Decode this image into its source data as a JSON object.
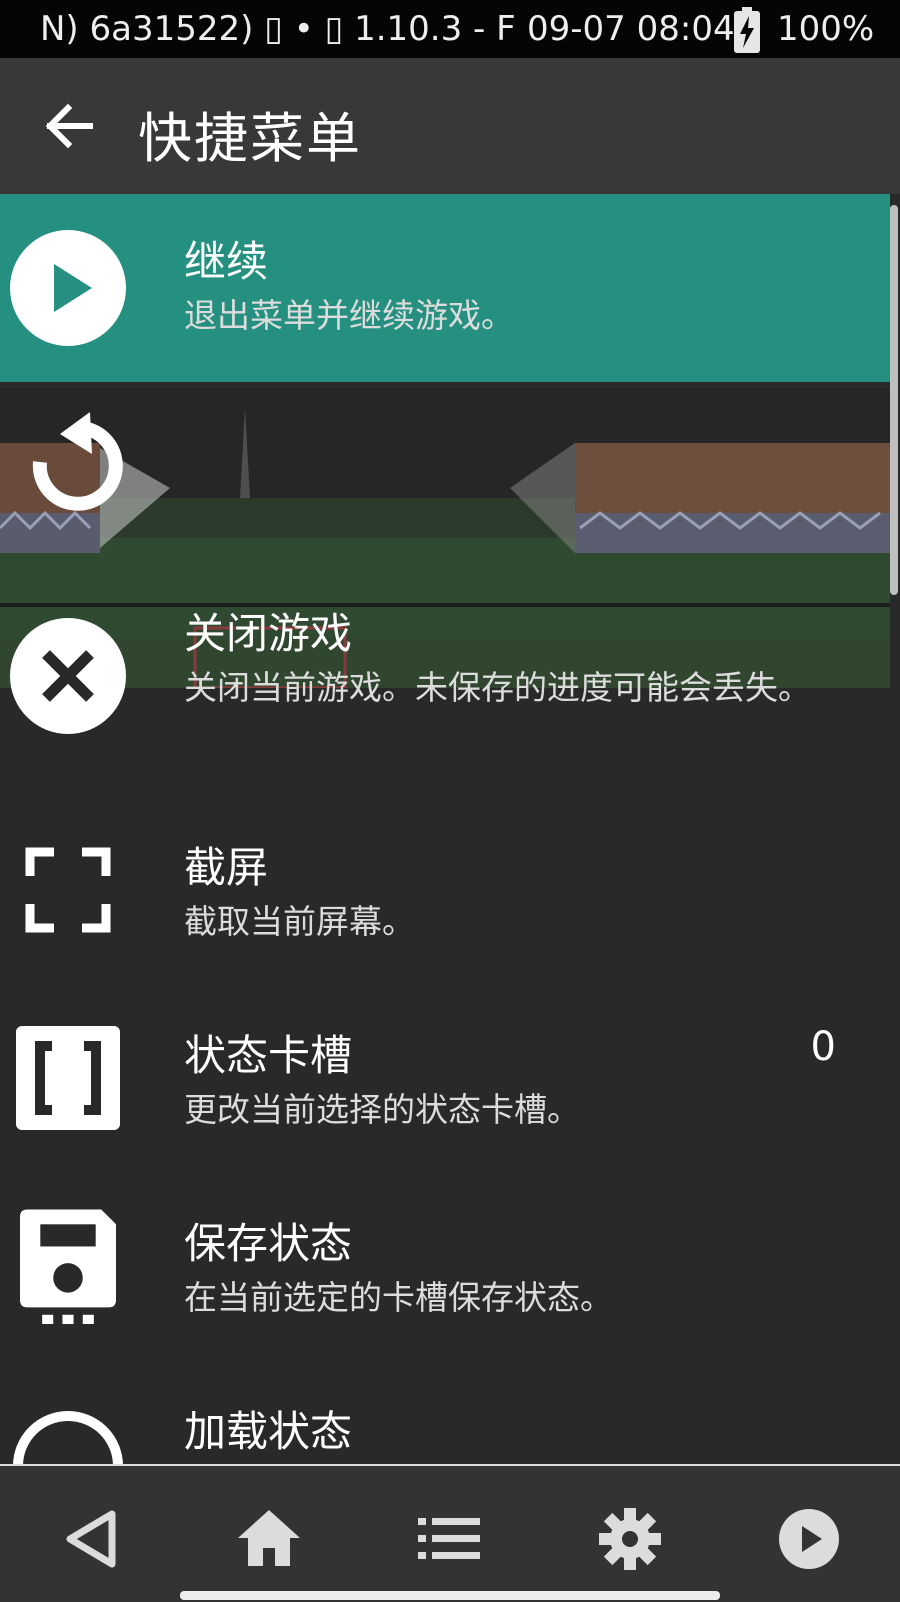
{
  "status_bar": {
    "left_text": "N) 6a31522) ▯ • ▯ 1.10.3 - F",
    "clock": "09-07 08:04",
    "battery_percent": "100%"
  },
  "header": {
    "title": "快捷菜单",
    "back_icon": "arrow-left-icon"
  },
  "menu": {
    "items": [
      {
        "title": "继续",
        "subtitle": "退出菜单并继续游戏。",
        "icon": "play-circle-icon",
        "selected": true
      },
      {
        "title": "",
        "subtitle": "",
        "icon": "reset-icon"
      },
      {
        "title": "关闭游戏",
        "subtitle": "关闭当前游戏。未保存的进度可能会丢失。",
        "icon": "close-circle-icon"
      },
      {
        "title": "截屏",
        "subtitle": "截取当前屏幕。",
        "icon": "screenshot-frame-icon"
      },
      {
        "title": "状态卡槽",
        "subtitle": "更改当前选择的状态卡槽。",
        "value": "0",
        "icon": "state-slot-icon"
      },
      {
        "title": "保存状态",
        "subtitle": "在当前选定的卡槽保存状态。",
        "icon": "save-state-icon"
      },
      {
        "title": "加载状态",
        "subtitle": "",
        "icon": "load-state-icon"
      }
    ]
  },
  "bottom_nav": {
    "icons": [
      "back-triangle-icon",
      "home-icon",
      "list-icon",
      "settings-icon",
      "play-circle-icon"
    ]
  },
  "colors": {
    "accent": "#259080",
    "background": "#292929",
    "appbar": "#383838",
    "bottombar": "#333333"
  }
}
